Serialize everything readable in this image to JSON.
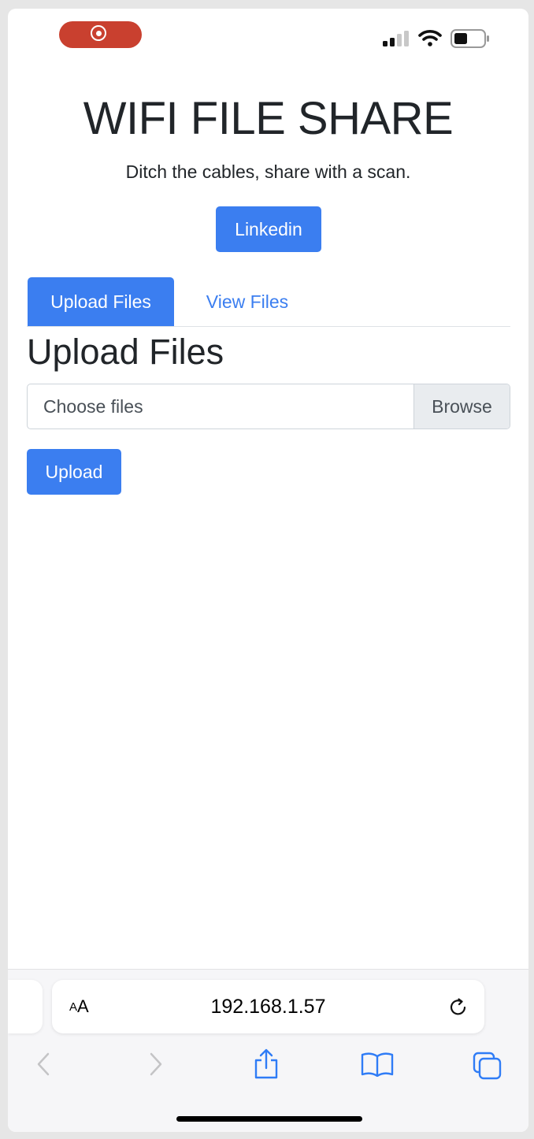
{
  "status_bar": {
    "recording_indicator": "record-icon",
    "icons": [
      "signal-icon",
      "wifi-icon",
      "battery-icon"
    ]
  },
  "page": {
    "title": "WIFI FILE SHARE",
    "tagline": "Ditch the cables, share with a scan.",
    "linkedin_label": "Linkedin"
  },
  "tabs": [
    {
      "label": "Upload Files",
      "active": true
    },
    {
      "label": "View Files",
      "active": false
    }
  ],
  "upload": {
    "heading": "Upload Files",
    "file_placeholder": "Choose files",
    "browse_label": "Browse",
    "upload_label": "Upload"
  },
  "browser": {
    "text_size_small": "A",
    "text_size_large": "A",
    "url": "192.168.1.57",
    "toolbar_icons": [
      "back-icon",
      "forward-icon",
      "share-icon",
      "bookmarks-icon",
      "tabs-icon"
    ]
  },
  "colors": {
    "accent": "#3b7ef0",
    "record": "#c9402f",
    "text": "#212529"
  }
}
